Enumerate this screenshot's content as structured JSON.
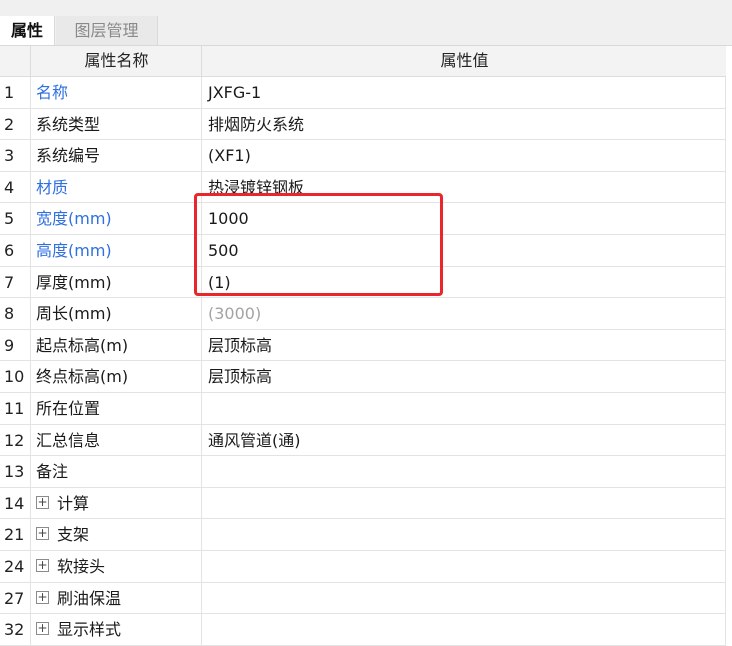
{
  "tabs": [
    {
      "label": "属性"
    },
    {
      "label": "图层管理"
    }
  ],
  "grid": {
    "header_name": "属性名称",
    "header_value": "属性值",
    "rows": [
      {
        "num": "1",
        "name": "名称",
        "value": "JXFG-1",
        "name_color": "#2f6fe0"
      },
      {
        "num": "2",
        "name": "系统类型",
        "value": "排烟防火系统"
      },
      {
        "num": "3",
        "name": "系统编号",
        "value": "(XF1)"
      },
      {
        "num": "4",
        "name": "材质",
        "value": "热浸镀锌钢板",
        "name_color": "#2f6fe0"
      },
      {
        "num": "5",
        "name": "宽度(mm)",
        "value": "1000",
        "name_color": "#2f6fe0"
      },
      {
        "num": "6",
        "name": "高度(mm)",
        "value": "500",
        "name_color": "#2f6fe0"
      },
      {
        "num": "7",
        "name": "厚度(mm)",
        "value": "(1)"
      },
      {
        "num": "8",
        "name": "周长(mm)",
        "value": "(3000)",
        "value_color": "#a3a3a3"
      },
      {
        "num": "9",
        "name": "起点标高(m)",
        "value": "层顶标高"
      },
      {
        "num": "10",
        "name": "终点标高(m)",
        "value": "层顶标高"
      },
      {
        "num": "11",
        "name": "所在位置",
        "value": ""
      },
      {
        "num": "12",
        "name": "汇总信息",
        "value": "通风管道(通)"
      },
      {
        "num": "13",
        "name": "备注",
        "value": ""
      },
      {
        "num": "14",
        "name": "计算",
        "value": "",
        "expandable": true
      },
      {
        "num": "21",
        "name": "支架",
        "value": "",
        "expandable": true
      },
      {
        "num": "24",
        "name": "软接头",
        "value": "",
        "expandable": true
      },
      {
        "num": "27",
        "name": "刷油保温",
        "value": "",
        "expandable": true
      },
      {
        "num": "32",
        "name": "显示样式",
        "value": "",
        "expandable": true
      }
    ]
  },
  "highlight": {
    "color": "#e8262b"
  },
  "icons": {
    "expand": "plus-box-icon"
  }
}
